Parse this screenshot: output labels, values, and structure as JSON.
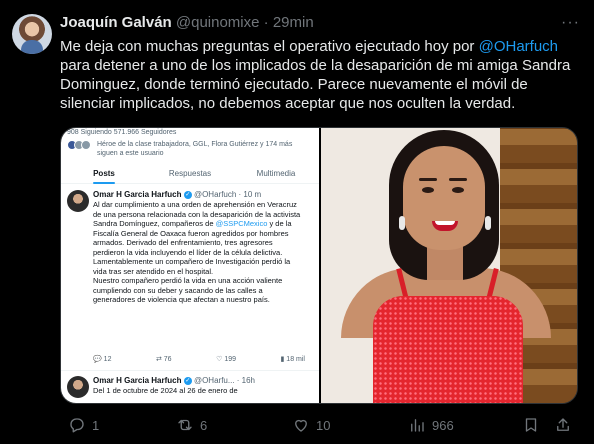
{
  "author": {
    "name": "Joaquín Galván",
    "handle": "@quinomixe",
    "dot": "·",
    "time": "29min"
  },
  "more_icon": "more-horizontal-icon",
  "tweet": {
    "text_before": "Me deja con muchas preguntas el operativo ejecutado hoy por ",
    "mention": "@OHarfuch",
    "text_after": " para detener a uno de los implicados de la desaparición de mi amiga Sandra Dominguez, donde terminó ejecutado. Parece nuevamente el móvil de silenciar implicados, no debemos aceptar que nos oculten la verdad."
  },
  "screenshot": {
    "topline": "908 Siguiendo  571.966 Seguidores",
    "followers_text": "Héroe de la clase trabajadora, GGL, Flora Gutiérrez y 174 más siguen a este usuario",
    "tabs": [
      "Posts",
      "Respuestas",
      "Multimedia"
    ],
    "post1": {
      "name": "Omar H Garcia Harfuch",
      "handle": "@OHarfuch · 10 m",
      "body_1": "Al dar cumplimiento a una orden de aprehensión en Veracruz de una persona relacionada con la desaparición de la activista Sandra Domínguez, compañeros de ",
      "mention": "@SSPCMexico",
      "body_2": " y de la Fiscalía General de Oaxaca fueron agredidos por hombres armados. Derivado del enfrentamiento, tres agresores perdieron la vida incluyendo el líder de la célula delictiva.  Lamentablemente un compañero de Investigación perdió la vida tras ser atendido en el hospital.\nNuestro compañero perdió la vida en una acción valiente cumpliendo con su deber y sacando de las calles a generadores de violencia que afectan a nuestro país.",
      "stats": {
        "replies": "12",
        "reposts": "76",
        "likes": "199",
        "views": "18 mil"
      }
    },
    "post2": {
      "name": "Omar H Garcia Harfuch",
      "handle": "@OHarfu... · 16h",
      "body": "Del 1 de octubre de 2024 al 26 de enero de"
    }
  },
  "actions": {
    "replies": "1",
    "reposts": "6",
    "likes": "10",
    "views": "966"
  },
  "colors": {
    "background": "#000000",
    "text": "#e7e9ea",
    "muted": "#71767b",
    "accent": "#1d9bf0"
  }
}
